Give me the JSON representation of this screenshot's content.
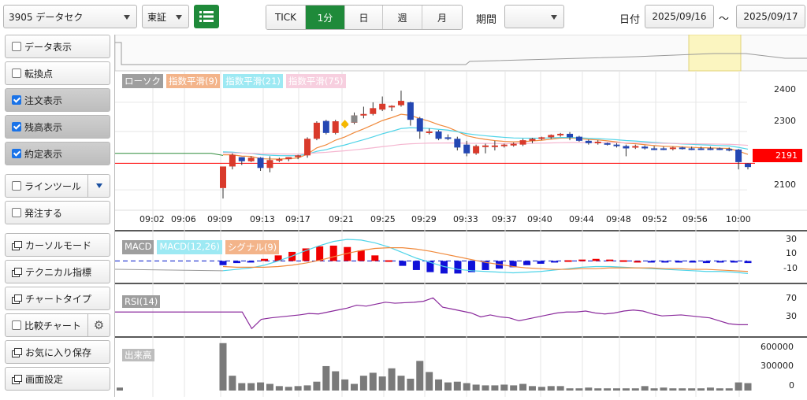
{
  "header": {
    "symbol": "3905 データセク",
    "market": "東証",
    "intervals": [
      "TICK",
      "1分",
      "日",
      "週",
      "月"
    ],
    "active_interval": "1分",
    "period_label": "期間",
    "period_value": "",
    "date_label": "日付",
    "date_from": "2025/09/16",
    "date_sep": "～",
    "date_to": "2025/09/17"
  },
  "sidebar": {
    "items": [
      {
        "label": "データ表示",
        "kind": "check",
        "checked": false
      },
      {
        "label": "転換点",
        "kind": "check",
        "checked": false
      },
      {
        "label": "注文表示",
        "kind": "check",
        "checked": true
      },
      {
        "label": "残高表示",
        "kind": "check",
        "checked": true
      },
      {
        "label": "約定表示",
        "kind": "check",
        "checked": true
      },
      {
        "label": "ラインツール",
        "kind": "check",
        "checked": false
      },
      {
        "label": "発注する",
        "kind": "check",
        "checked": false
      },
      {
        "label": "カーソルモード",
        "kind": "window"
      },
      {
        "label": "テクニカル指標",
        "kind": "window"
      },
      {
        "label": "チャートタイプ",
        "kind": "window"
      },
      {
        "label": "比較チャート",
        "kind": "check",
        "checked": false
      },
      {
        "label": "お気に入り保存",
        "kind": "window"
      },
      {
        "label": "画面設定",
        "kind": "window"
      }
    ]
  },
  "colors": {
    "accent_green": "#1f8a3a",
    "candle_up": "#d93a2b",
    "candle_down": "#2447b3",
    "ema9": "#f08a3c",
    "ema21": "#4fd4e8",
    "ema75": "#f5b6d0",
    "price_marker": "#ff0000"
  },
  "chart_data": [
    {
      "type": "candlestick",
      "title": "ローソク",
      "legend": [
        "ローソク",
        "指数平滑(9)",
        "指数平滑(21)",
        "指数平滑(75)"
      ],
      "x_ticks": [
        "09:02",
        "09:06",
        "09:09",
        "09:13",
        "09:17",
        "09:21",
        "09:25",
        "09:29",
        "09:33",
        "09:37",
        "09:40",
        "09:44",
        "09:48",
        "09:52",
        "09:56",
        "10:00"
      ],
      "y_ticks": [
        2100,
        2300,
        2400
      ],
      "ylim": [
        2030,
        2470
      ],
      "last_price": "2191",
      "candles": [
        {
          "o": 2106,
          "h": 2106,
          "l": 2070,
          "c": 2180
        },
        {
          "o": 2180,
          "h": 2225,
          "l": 2170,
          "c": 2220
        },
        {
          "o": 2212,
          "h": 2212,
          "l": 2185,
          "c": 2198
        },
        {
          "o": 2198,
          "h": 2215,
          "l": 2195,
          "c": 2210
        },
        {
          "o": 2210,
          "h": 2212,
          "l": 2165,
          "c": 2175
        },
        {
          "o": 2175,
          "h": 2215,
          "l": 2160,
          "c": 2202
        },
        {
          "o": 2202,
          "h": 2210,
          "l": 2195,
          "c": 2205
        },
        {
          "o": 2205,
          "h": 2212,
          "l": 2198,
          "c": 2212
        },
        {
          "o": 2212,
          "h": 2220,
          "l": 2205,
          "c": 2218
        },
        {
          "o": 2218,
          "h": 2280,
          "l": 2210,
          "c": 2275
        },
        {
          "o": 2275,
          "h": 2335,
          "l": 2270,
          "c": 2330
        },
        {
          "o": 2336,
          "h": 2340,
          "l": 2290,
          "c": 2295
        },
        {
          "o": 2295,
          "h": 2340,
          "l": 2290,
          "c": 2335
        },
        {
          "o": 2325,
          "h": 2335,
          "l": 2318,
          "c": 2325
        },
        {
          "o": 2330,
          "h": 2365,
          "l": 2325,
          "c": 2355
        },
        {
          "o": 2355,
          "h": 2385,
          "l": 2345,
          "c": 2360
        },
        {
          "o": 2360,
          "h": 2400,
          "l": 2355,
          "c": 2380
        },
        {
          "o": 2375,
          "h": 2420,
          "l": 2370,
          "c": 2395
        },
        {
          "o": 2385,
          "h": 2390,
          "l": 2370,
          "c": 2388
        },
        {
          "o": 2390,
          "h": 2440,
          "l": 2385,
          "c": 2405
        },
        {
          "o": 2400,
          "h": 2402,
          "l": 2320,
          "c": 2340
        },
        {
          "o": 2345,
          "h": 2350,
          "l": 2275,
          "c": 2300
        },
        {
          "o": 2300,
          "h": 2310,
          "l": 2290,
          "c": 2300
        },
        {
          "o": 2300,
          "h": 2305,
          "l": 2270,
          "c": 2275
        },
        {
          "o": 2280,
          "h": 2290,
          "l": 2270,
          "c": 2278
        },
        {
          "o": 2275,
          "h": 2282,
          "l": 2235,
          "c": 2245
        },
        {
          "o": 2255,
          "h": 2268,
          "l": 2215,
          "c": 2225
        },
        {
          "o": 2225,
          "h": 2255,
          "l": 2220,
          "c": 2250
        },
        {
          "o": 2250,
          "h": 2258,
          "l": 2225,
          "c": 2252
        },
        {
          "o": 2250,
          "h": 2268,
          "l": 2235,
          "c": 2252
        },
        {
          "o": 2252,
          "h": 2258,
          "l": 2245,
          "c": 2255
        },
        {
          "o": 2252,
          "h": 2262,
          "l": 2248,
          "c": 2258
        },
        {
          "o": 2255,
          "h": 2275,
          "l": 2250,
          "c": 2270
        },
        {
          "o": 2268,
          "h": 2278,
          "l": 2260,
          "c": 2275
        },
        {
          "o": 2275,
          "h": 2282,
          "l": 2270,
          "c": 2280
        },
        {
          "o": 2280,
          "h": 2290,
          "l": 2275,
          "c": 2288
        },
        {
          "o": 2288,
          "h": 2295,
          "l": 2282,
          "c": 2292
        },
        {
          "o": 2292,
          "h": 2298,
          "l": 2270,
          "c": 2280
        },
        {
          "o": 2282,
          "h": 2285,
          "l": 2265,
          "c": 2268
        },
        {
          "o": 2268,
          "h": 2272,
          "l": 2255,
          "c": 2260
        },
        {
          "o": 2260,
          "h": 2270,
          "l": 2255,
          "c": 2265
        },
        {
          "o": 2260,
          "h": 2262,
          "l": 2252,
          "c": 2255
        },
        {
          "o": 2255,
          "h": 2260,
          "l": 2245,
          "c": 2250
        },
        {
          "o": 2250,
          "h": 2255,
          "l": 2215,
          "c": 2242
        },
        {
          "o": 2245,
          "h": 2255,
          "l": 2240,
          "c": 2250
        },
        {
          "o": 2248,
          "h": 2252,
          "l": 2238,
          "c": 2242
        },
        {
          "o": 2242,
          "h": 2250,
          "l": 2236,
          "c": 2240
        },
        {
          "o": 2242,
          "h": 2248,
          "l": 2236,
          "c": 2240
        },
        {
          "o": 2240,
          "h": 2248,
          "l": 2235,
          "c": 2245
        },
        {
          "o": 2245,
          "h": 2248,
          "l": 2238,
          "c": 2240
        },
        {
          "o": 2242,
          "h": 2248,
          "l": 2236,
          "c": 2240
        },
        {
          "o": 2242,
          "h": 2248,
          "l": 2236,
          "c": 2240
        },
        {
          "o": 2242,
          "h": 2248,
          "l": 2236,
          "c": 2240
        },
        {
          "o": 2242,
          "h": 2245,
          "l": 2236,
          "c": 2240
        },
        {
          "o": 2240,
          "h": 2245,
          "l": 2232,
          "c": 2238
        },
        {
          "o": 2238,
          "h": 2240,
          "l": 2170,
          "c": 2195
        },
        {
          "o": 2190,
          "h": 2192,
          "l": 2170,
          "c": 2178
        }
      ]
    },
    {
      "type": "line",
      "title": "MACD",
      "legend": [
        "MACD",
        "MACD(12,26)",
        "シグナル(9)"
      ],
      "y_ticks": [
        30,
        10,
        -10
      ],
      "ylim": [
        -30,
        40
      ],
      "macd": [
        -14,
        -12,
        -10,
        -6,
        0,
        7,
        15,
        22,
        28,
        31,
        30,
        26,
        20,
        12,
        4,
        -2,
        -8,
        -12,
        -14,
        -15,
        -16,
        -17,
        -16,
        -15,
        -13,
        -11,
        -9,
        -8,
        -8,
        -9,
        -10,
        -11,
        -12,
        -13,
        -14,
        -15,
        -15,
        -16,
        -18
      ],
      "signal": [
        -8,
        -9,
        -9,
        -9,
        -8,
        -6,
        -3,
        1,
        6,
        11,
        15,
        18,
        19,
        19,
        17,
        14,
        10,
        6,
        2,
        -2,
        -5,
        -8,
        -10,
        -11,
        -12,
        -12,
        -11,
        -11,
        -10,
        -10,
        -10,
        -10,
        -11,
        -11,
        -12,
        -12,
        -13,
        -14,
        -15
      ],
      "histogram": [
        -6,
        -3,
        -1,
        3,
        8,
        13,
        18,
        21,
        22,
        20,
        15,
        8,
        1,
        -7,
        -13,
        -16,
        -18,
        -18,
        -16,
        -13,
        -11,
        -9,
        -6,
        -4,
        -1,
        1,
        2,
        3,
        2,
        1,
        0,
        -1,
        -1,
        -2,
        -2,
        -3,
        -2,
        -2,
        -3
      ]
    },
    {
      "type": "line",
      "title": "RSI(14)",
      "y_ticks": [
        70,
        30
      ],
      "ylim": [
        0,
        100
      ],
      "values": [
        48,
        48,
        48,
        48,
        14,
        33,
        36,
        38,
        40,
        42,
        45,
        44,
        48,
        52,
        56,
        62,
        60,
        64,
        68,
        66,
        67,
        68,
        70,
        77,
        58,
        54,
        50,
        46,
        38,
        42,
        38,
        36,
        30,
        34,
        38,
        42,
        46,
        48,
        48,
        50,
        46,
        44,
        46,
        50,
        52,
        50,
        44,
        40,
        41,
        42,
        40,
        38,
        36,
        30,
        24,
        22,
        22
      ]
    },
    {
      "type": "bar",
      "title": "出来高",
      "y_ticks": [
        600000,
        300000,
        0
      ],
      "ylim": [
        0,
        680000
      ],
      "values": [
        40000,
        0,
        0,
        0,
        0,
        0,
        0,
        0,
        0,
        0,
        0,
        0,
        0,
        0,
        0,
        0,
        0,
        0,
        0,
        0,
        0,
        0,
        0,
        0,
        0,
        0,
        0,
        0,
        0,
        0,
        0,
        0,
        0,
        0,
        0,
        0,
        0,
        0,
        0,
        0,
        0,
        0,
        0,
        0,
        0,
        0,
        0,
        0,
        0,
        0,
        0,
        0,
        0,
        0,
        0,
        0,
        0,
        0,
        0,
        0,
        0,
        0,
        0,
        0,
        0,
        0,
        0,
        0,
        0,
        0,
        0,
        0,
        0,
        0,
        0,
        0,
        0,
        0,
        0,
        0,
        0,
        0,
        0,
        0,
        0,
        0,
        0,
        0,
        0,
        0,
        0,
        0,
        0,
        0,
        0,
        0,
        0,
        0,
        0,
        0,
        0,
        0,
        0,
        0,
        0,
        0,
        0,
        0,
        0,
        0,
        0,
        0,
        0,
        0,
        0,
        0,
        0,
        0,
        0,
        0,
        0,
        0,
        0,
        0,
        0,
        0,
        0,
        0,
        0,
        0,
        0,
        0,
        0,
        0,
        0,
        0,
        0,
        0,
        0,
        0,
        0,
        0,
        0,
        0,
        0,
        0,
        0,
        0,
        0,
        0,
        0,
        0,
        0,
        0,
        0,
        0,
        0,
        0,
        0,
        0,
        0,
        0,
        0,
        0,
        0,
        0,
        0,
        0,
        0,
        0,
        0,
        0,
        0,
        0,
        0,
        0,
        0,
        0,
        0,
        0,
        0,
        0,
        0,
        0,
        0,
        0,
        0,
        0,
        0,
        0,
        0,
        0,
        0,
        0,
        0,
        0,
        0,
        0,
        0,
        0,
        0,
        0,
        0,
        0,
        0,
        0,
        0,
        0,
        0,
        0,
        0,
        0,
        0,
        0,
        0,
        0,
        0,
        0,
        0,
        0,
        0,
        0,
        0,
        0,
        0,
        0,
        0,
        0,
        0,
        0,
        0,
        0,
        0,
        0,
        0,
        0,
        0,
        0,
        0,
        0,
        0,
        0,
        0,
        0,
        0,
        0
      ],
      "session_values": [
        640000,
        200000,
        100000,
        100000,
        110000,
        90000,
        60000,
        50000,
        60000,
        70000,
        120000,
        330000,
        260000,
        150000,
        90000,
        200000,
        240000,
        190000,
        300000,
        200000,
        160000,
        400000,
        250000,
        150000,
        110000,
        120000,
        100000,
        80000,
        70000,
        70000,
        80000,
        70000,
        90000,
        60000,
        50000,
        60000,
        60000,
        30000,
        30000,
        40000,
        30000,
        30000,
        30000,
        30000,
        30000,
        60000,
        30000,
        40000,
        30000,
        30000,
        30000,
        30000,
        40000,
        30000,
        30000,
        110000,
        100000
      ]
    }
  ]
}
